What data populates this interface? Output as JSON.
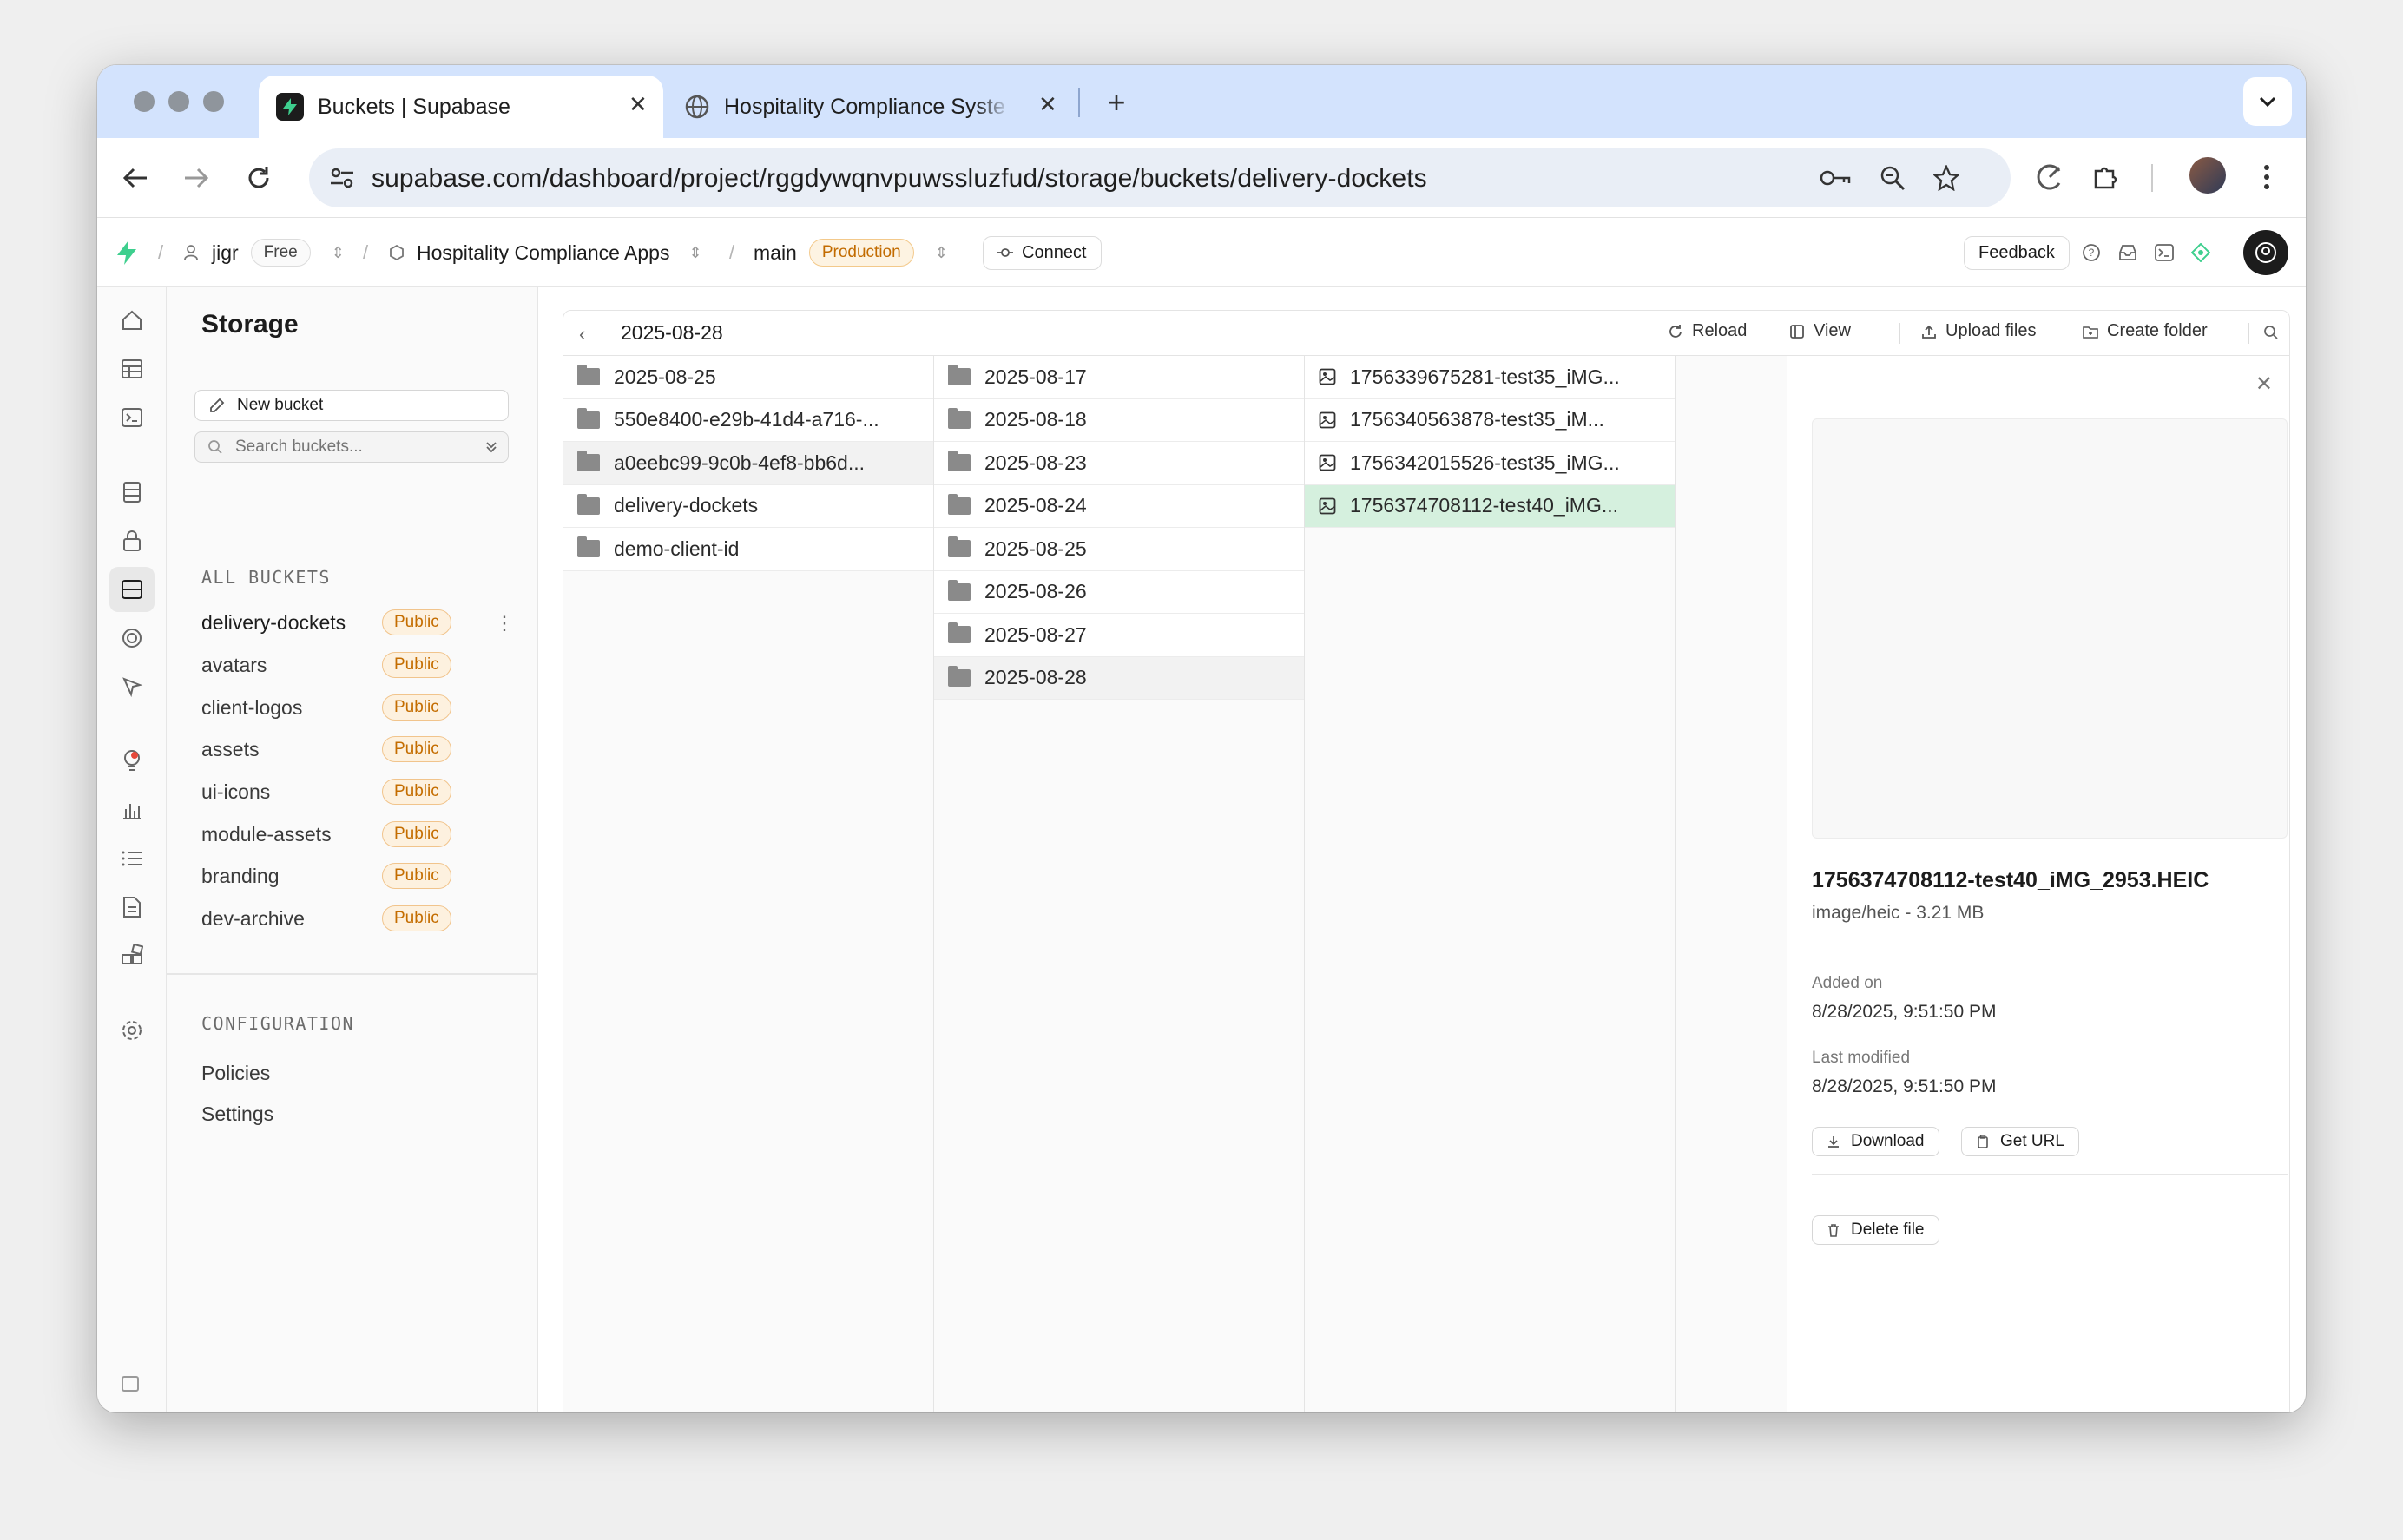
{
  "browser": {
    "tabs": [
      {
        "title": "Buckets | Supabase",
        "active": true
      },
      {
        "title": "Hospitality Compliance Syste",
        "active": false
      }
    ],
    "url": "supabase.com/dashboard/project/rggdywqnvpuwssluzfud/storage/buckets/delivery-dockets"
  },
  "header": {
    "org": "jigr",
    "plan": "Free",
    "project": "Hospitality Compliance Apps",
    "branch": "main",
    "env": "Production",
    "connect": "Connect",
    "feedback": "Feedback"
  },
  "sidebar": {
    "title": "Storage",
    "new_bucket": "New bucket",
    "search_placeholder": "Search buckets...",
    "all_buckets_label": "ALL BUCKETS",
    "buckets": [
      {
        "name": "delivery-dockets",
        "badge": "Public"
      },
      {
        "name": "avatars",
        "badge": "Public"
      },
      {
        "name": "client-logos",
        "badge": "Public"
      },
      {
        "name": "assets",
        "badge": "Public"
      },
      {
        "name": "ui-icons",
        "badge": "Public"
      },
      {
        "name": "module-assets",
        "badge": "Public"
      },
      {
        "name": "branding",
        "badge": "Public"
      },
      {
        "name": "dev-archive",
        "badge": "Public"
      }
    ],
    "config_label": "CONFIGURATION",
    "config_links": [
      "Policies",
      "Settings"
    ]
  },
  "explorer": {
    "path": "2025-08-28",
    "actions": {
      "reload": "Reload",
      "view": "View",
      "upload": "Upload files",
      "create_folder": "Create folder"
    },
    "col1": [
      "2025-08-25",
      "550e8400-e29b-41d4-a716-...",
      "a0eebc99-9c0b-4ef8-bb6d...",
      "delivery-dockets",
      "demo-client-id"
    ],
    "col2": [
      "2025-08-17",
      "2025-08-18",
      "2025-08-23",
      "2025-08-24",
      "2025-08-25",
      "2025-08-26",
      "2025-08-27",
      "2025-08-28"
    ],
    "col3": [
      "1756339675281-test35_iMG...",
      "1756340563878-test35_iM...",
      "1756342015526-test35_iMG...",
      "1756374708112-test40_iMG..."
    ]
  },
  "detail": {
    "filename": "1756374708112-test40_iMG_2953.HEIC",
    "meta": "image/heic - 3.21 MB",
    "added_label": "Added on",
    "added_value": "8/28/2025, 9:51:50 PM",
    "modified_label": "Last modified",
    "modified_value": "8/28/2025, 9:51:50 PM",
    "download": "Download",
    "get_url": "Get URL",
    "delete": "Delete file"
  },
  "colors": {
    "accent_green": "#3ecf8e",
    "selected_row": "#d5f0de",
    "badge_orange": "#c46d00"
  }
}
